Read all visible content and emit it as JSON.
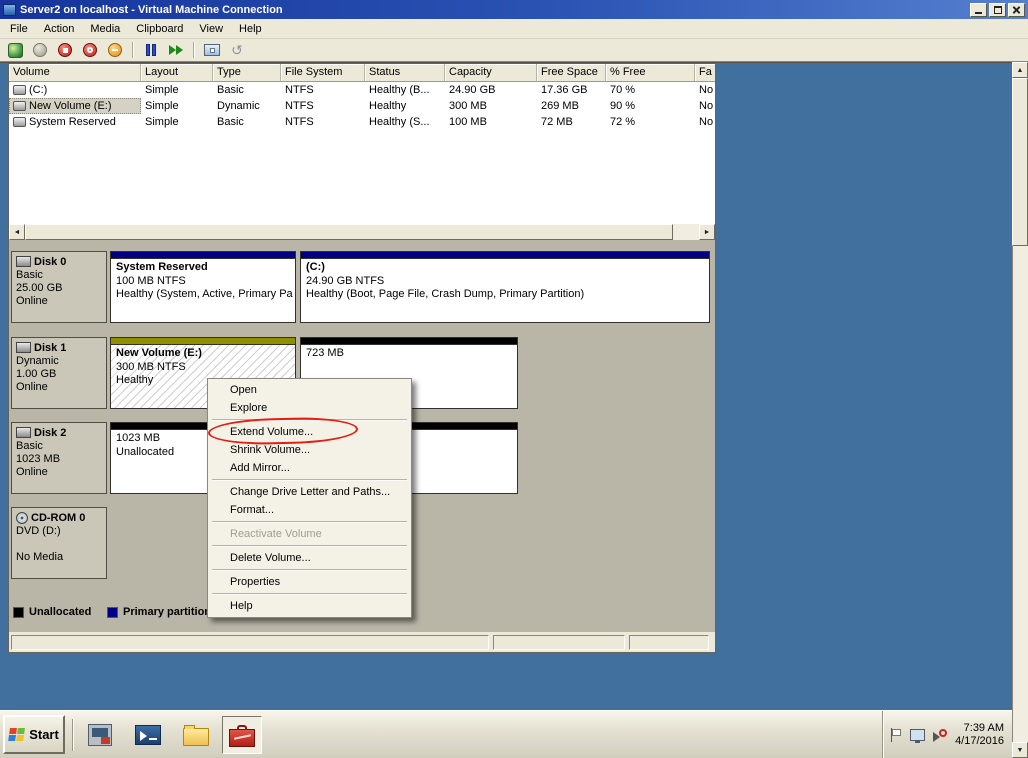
{
  "titlebar": {
    "title": "Server2 on localhost - Virtual Machine Connection"
  },
  "menubar": {
    "items": [
      "File",
      "Action",
      "Media",
      "Clipboard",
      "View",
      "Help"
    ]
  },
  "toolbar": {
    "icons": [
      "ctrl-alt-del",
      "start",
      "turn-off",
      "shut-down",
      "save",
      "pause",
      "reset",
      "snapshot",
      "revert"
    ]
  },
  "glyphs": {
    "revert": "↺",
    "up": "▲",
    "down": "▼",
    "left": "◄",
    "right": "►"
  },
  "volume_list": {
    "columns": [
      "Volume",
      "Layout",
      "Type",
      "File System",
      "Status",
      "Capacity",
      "Free Space",
      "% Free",
      "Fa"
    ],
    "rows": [
      [
        "(C:)",
        "Simple",
        "Basic",
        "NTFS",
        "Healthy (B...",
        "24.90 GB",
        "17.36 GB",
        "70 %",
        "No"
      ],
      [
        "New Volume (E:)",
        "Simple",
        "Dynamic",
        "NTFS",
        "Healthy",
        "300 MB",
        "269 MB",
        "90 %",
        "No"
      ],
      [
        "System Reserved",
        "Simple",
        "Basic",
        "NTFS",
        "Healthy (S...",
        "100 MB",
        "72 MB",
        "72 %",
        "No"
      ]
    ],
    "selected_row": "New Volume (E:)"
  },
  "disks": [
    {
      "name": "Disk 0",
      "type": "Basic",
      "size": "25.00 GB",
      "status": "Online",
      "partitions": [
        {
          "title": "System Reserved",
          "line2": "100 MB NTFS",
          "line3": "Healthy (System, Active, Primary Pa"
        },
        {
          "title": "(C:)",
          "line2": "24.90 GB NTFS",
          "line3": "Healthy (Boot, Page File, Crash Dump, Primary Partition)"
        }
      ]
    },
    {
      "name": "Disk 1",
      "type": "Dynamic",
      "size": "1.00 GB",
      "status": "Online",
      "partitions": [
        {
          "title": "New Volume  (E:)",
          "line2": "300 MB NTFS",
          "line3": "Healthy"
        },
        {
          "title": "723 MB",
          "line2": "",
          "line3": ""
        }
      ]
    },
    {
      "name": "Disk 2",
      "type": "Basic",
      "size": "1023 MB",
      "status": "Online",
      "partitions": [
        {
          "title": "1023 MB",
          "line2": "Unallocated",
          "line3": ""
        }
      ]
    },
    {
      "name": "CD-ROM 0",
      "type": "DVD (D:)",
      "size": "",
      "status": "No Media",
      "partitions": []
    }
  ],
  "legend": {
    "unallocated": "Unallocated",
    "primary": "Primary partition"
  },
  "context_menu": {
    "items": [
      {
        "label": "Open",
        "enabled": true
      },
      {
        "label": "Explore",
        "enabled": true
      },
      {
        "label": "Extend Volume...",
        "enabled": true,
        "annotated": true
      },
      {
        "label": "Shrink Volume...",
        "enabled": true
      },
      {
        "label": "Add Mirror...",
        "enabled": true
      },
      {
        "label": "Change Drive Letter and Paths...",
        "enabled": true
      },
      {
        "label": "Format...",
        "enabled": true
      },
      {
        "label": "Reactivate Volume",
        "enabled": false
      },
      {
        "label": "Delete Volume...",
        "enabled": true
      },
      {
        "label": "Properties",
        "enabled": true
      },
      {
        "label": "Help",
        "enabled": true
      }
    ]
  },
  "taskbar": {
    "start_label": "Start",
    "quick_launch": [
      "server-manager",
      "powershell",
      "windows-explorer",
      "disk-management"
    ]
  },
  "tray": {
    "icons": [
      "notification-flag",
      "network-status",
      "volume-muted"
    ],
    "time": "7:39 AM",
    "date": "4/17/2016"
  },
  "colors": {
    "desktop": "#41709e",
    "primary_partition": "#000084",
    "dynamic_volume": "#8f8f00",
    "unallocated": "#000000",
    "annotation_red": "#e31d12"
  }
}
